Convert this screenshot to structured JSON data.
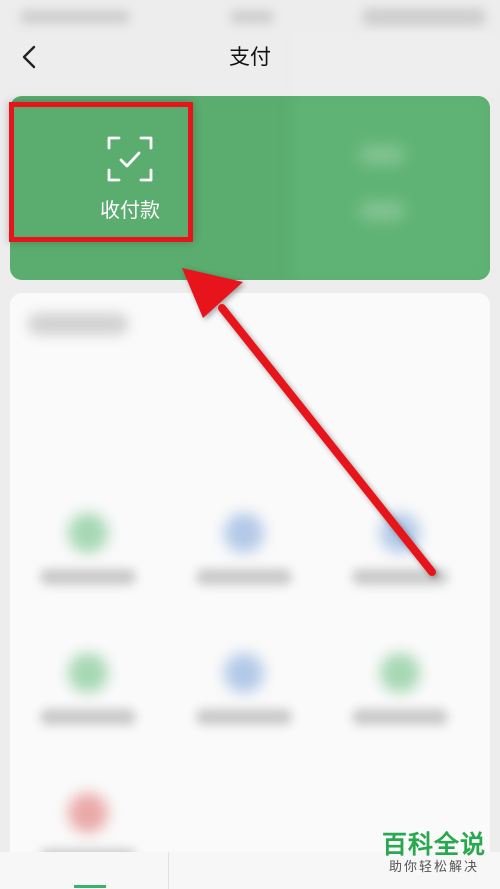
{
  "nav": {
    "title": "支付"
  },
  "pay_card": {
    "collect_label": "收付款",
    "card_color": "#5aad6e"
  },
  "annotation_color": "#e8141b",
  "watermark": {
    "title": "百科全说",
    "subtitle": "助你轻松解决"
  },
  "icons": {
    "back": "chevron-left-icon",
    "scan": "scan-check-icon"
  }
}
